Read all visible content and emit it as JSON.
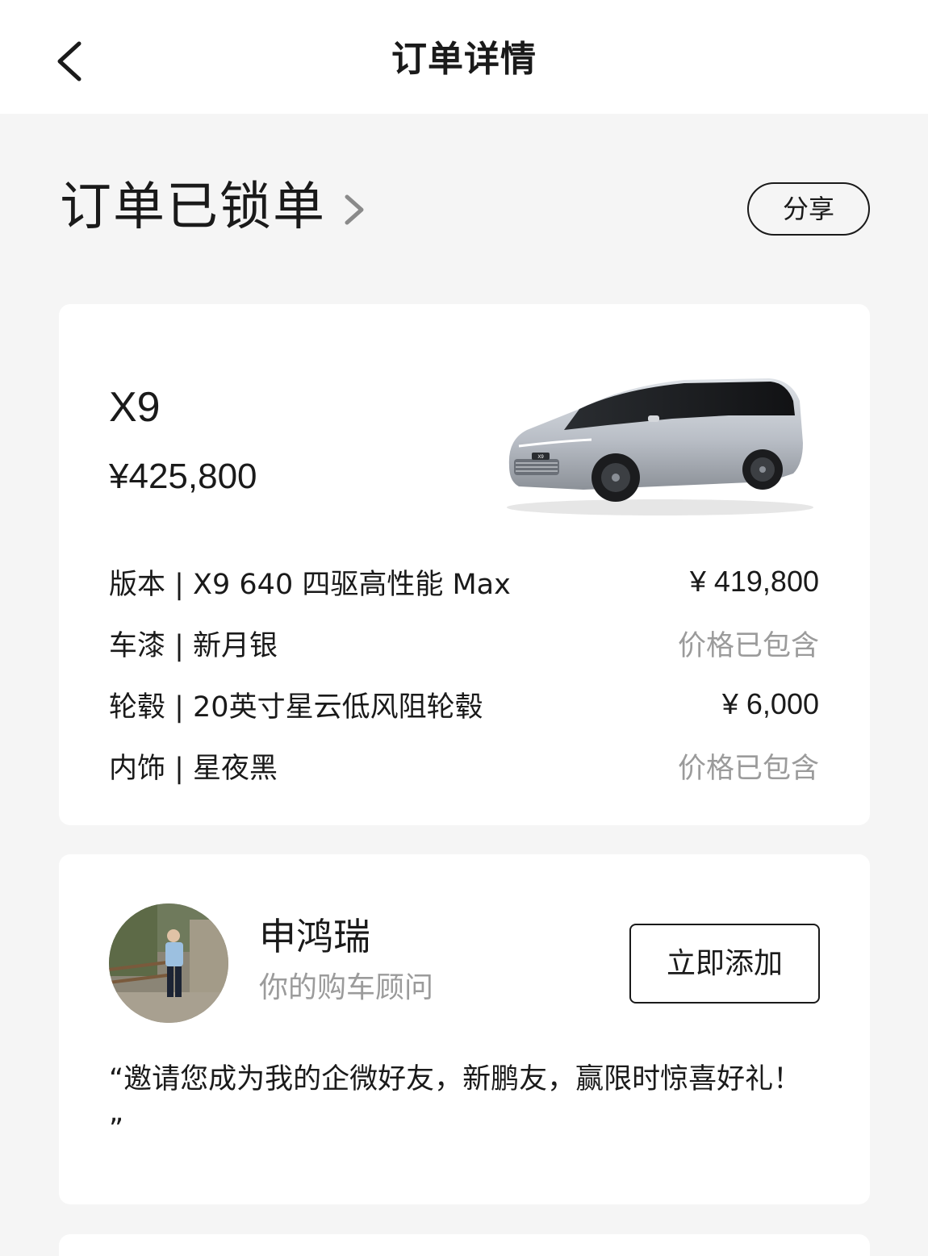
{
  "header": {
    "title": "订单详情"
  },
  "status": {
    "text": "订单已锁单",
    "share_label": "分享"
  },
  "car": {
    "model": "X9",
    "price": "¥425,800",
    "badge": "X9",
    "configs": [
      {
        "label": "版本 | X9 640 四驱高性能 Max",
        "value": "¥ 419,800",
        "muted": false
      },
      {
        "label": "车漆 | 新月银",
        "value": "价格已包含",
        "muted": true
      },
      {
        "label": "轮毂 | 20英寸星云低风阻轮毂",
        "value": "¥ 6,000",
        "muted": false
      },
      {
        "label": "内饰 | 星夜黑",
        "value": "价格已包含",
        "muted": true
      }
    ]
  },
  "advisor": {
    "name": "申鸿瑞",
    "role": "你的购车顾问",
    "add_label": "立即添加",
    "message": "“邀请您成为我的企微好友，新鹏友，赢限时惊喜好礼！ ”"
  },
  "colors": {
    "background": "#f5f5f5",
    "card": "#ffffff",
    "text": "#1a1a1a",
    "muted": "#9b9b9b"
  }
}
